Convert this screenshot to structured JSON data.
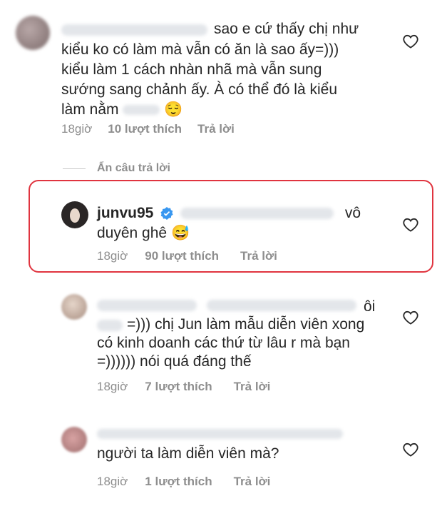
{
  "comments": [
    {
      "text_lines": [
        "sao e cứ thấy chị như",
        "kiểu ko có làm mà vẫn có ăn là sao ấy=)))",
        "kiểu làm 1 cách nhàn nhã mà vẫn sung",
        "sướng sang chảnh ấy. À có thể đó là kiểu",
        "làm nằm"
      ],
      "emoji": "😌",
      "time": "18giờ",
      "likes": "10 lượt thích",
      "reply": "Trả lời"
    },
    {
      "username": "junvu95",
      "text_lines": [
        "vô",
        "duyên ghê"
      ],
      "emoji": "😅",
      "time": "18giờ",
      "likes": "90 lượt thích",
      "reply": "Trả lời"
    },
    {
      "text_lines": [
        "ôi",
        "=))) chị Jun làm mẫu diễn viên xong",
        "có kinh doanh các thứ từ lâu r mà bạn",
        "=)))))) nói quá đáng thế"
      ],
      "time": "18giờ",
      "likes": "7 lượt thích",
      "reply": "Trả lời"
    },
    {
      "text_lines": [
        "người ta làm diễn viên mà?"
      ],
      "time": "18giờ",
      "likes": "1 lượt thích",
      "reply": "Trả lời"
    }
  ],
  "hide_replies": "Ẩn câu trả lời",
  "icons": {
    "like": "heart-outline-icon",
    "verified": "verified-badge-icon"
  },
  "colors": {
    "highlight": "#e0343f",
    "secondary_text": "#8e8e8e",
    "verified": "#3897f0"
  }
}
